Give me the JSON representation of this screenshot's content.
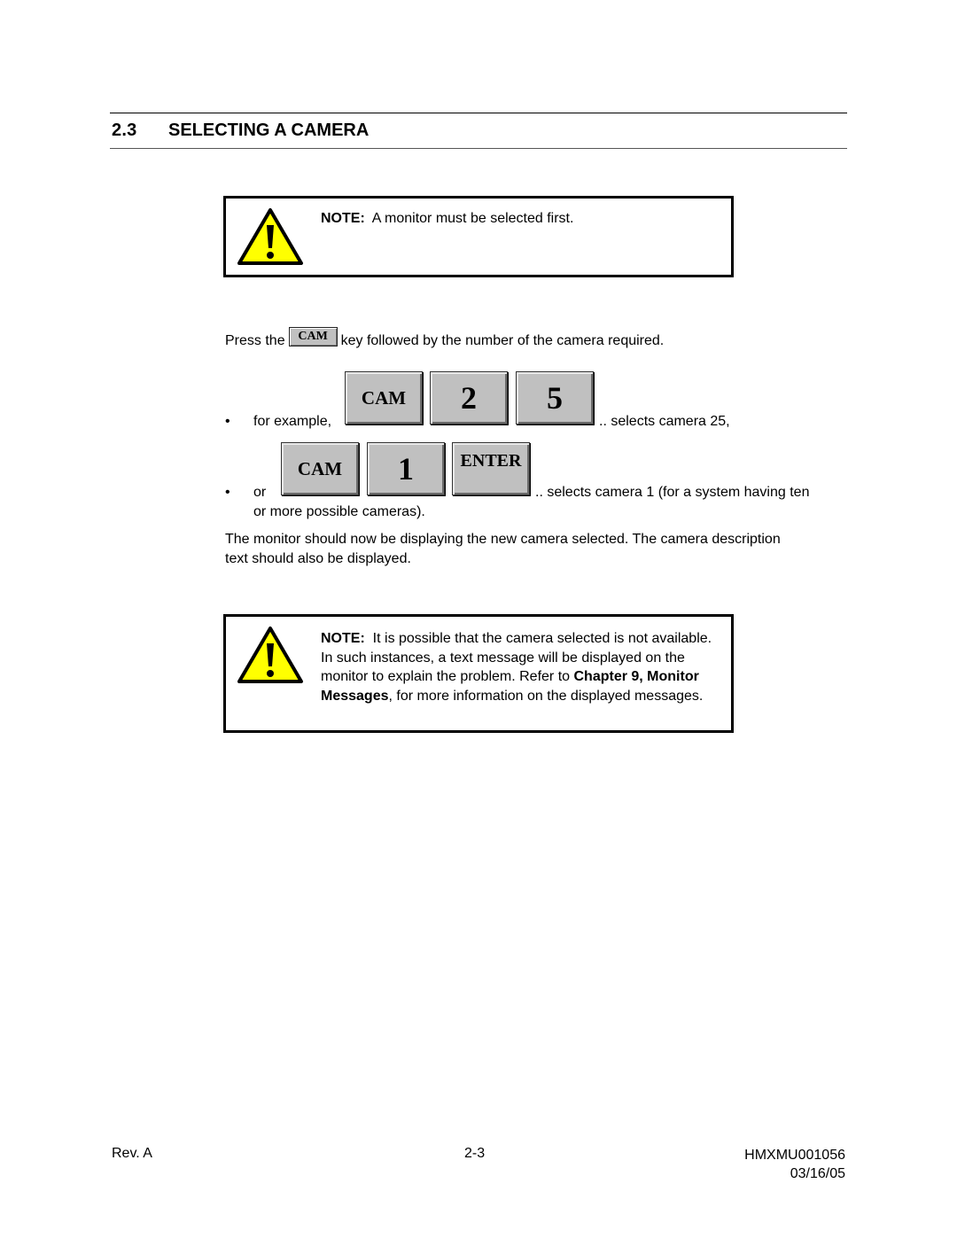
{
  "section": {
    "number": "2.3",
    "title": "SELECTING A CAMERA"
  },
  "notes": [
    {
      "icon": "warning-triangle-icon",
      "label": "NOTE:",
      "text": "A monitor must be selected first."
    },
    {
      "icon": "warning-triangle-icon",
      "label": "NOTE:",
      "text_before": "It is possible that the camera selected is not available.  In such instances, a text message will be displayed on the monitor to explain the problem.  Refer to",
      "link_text": "Chapter 9, Monitor Messages",
      "text_after": ", for more information on the displayed messages."
    }
  ],
  "instruction": {
    "prefix": "Press the",
    "key": "CAM",
    "suffix": "key followed by the number of the camera required."
  },
  "examples": [
    {
      "bullet": "•",
      "prefix": "for example,",
      "keys": [
        "CAM",
        "2",
        "5"
      ],
      "suffix": ".. selects camera 25,"
    },
    {
      "bullet": "•",
      "prefix": "or",
      "keys": [
        "CAM",
        "1",
        "ENTER"
      ],
      "suffix": ".. selects camera 1 (for a system having  ten",
      "continuation": "or more possible cameras)."
    }
  ],
  "paragraph": "The monitor should now be displaying the new camera selected.  The camera description text should also be displayed.",
  "footer": {
    "revision": "Rev. A",
    "page": "2-3",
    "doc_id": "HMXMU001056",
    "date": "03/16/05"
  },
  "colors": {
    "warning_fill": "#ffff00",
    "key_face": "#c0c0c0"
  }
}
